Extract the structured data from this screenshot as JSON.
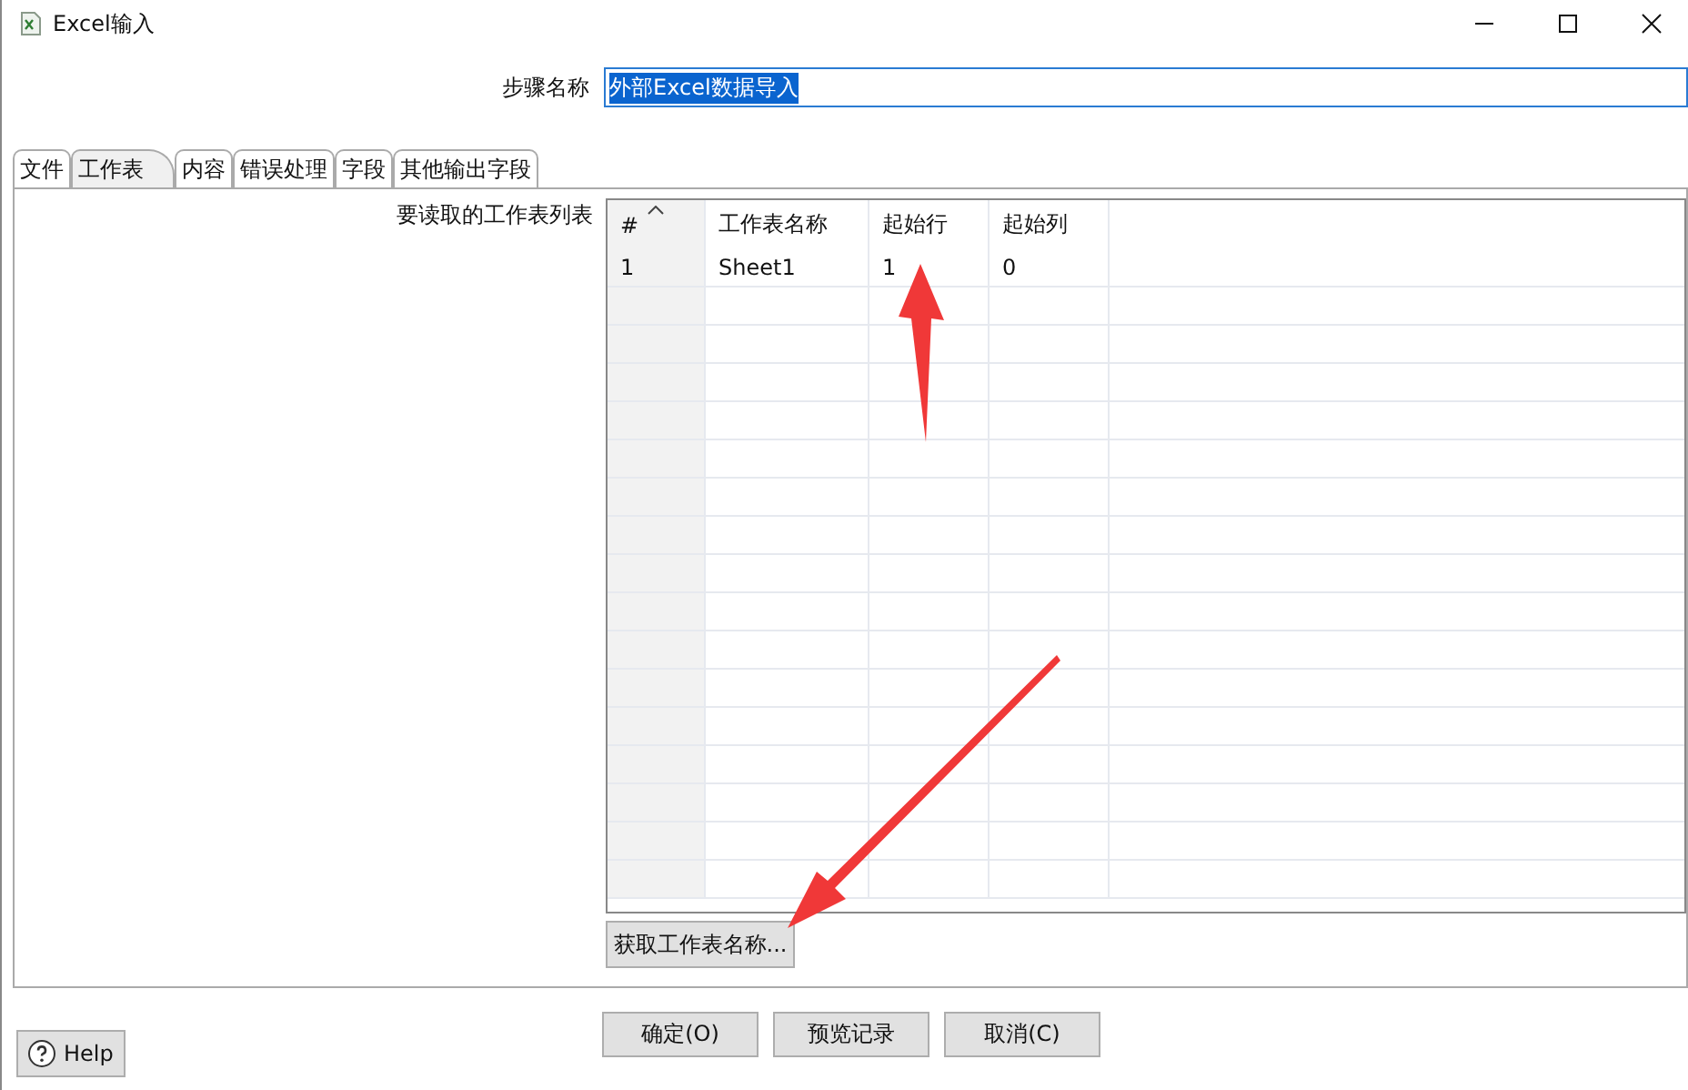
{
  "window": {
    "title": "Excel输入"
  },
  "step_name": {
    "label": "步骤名称",
    "value": "外部Excel数据导入"
  },
  "tabs": [
    {
      "label": "文件",
      "selected": false
    },
    {
      "label": "工作表",
      "selected": true
    },
    {
      "label": "内容",
      "selected": false
    },
    {
      "label": "错误处理",
      "selected": false
    },
    {
      "label": "字段",
      "selected": false
    },
    {
      "label": "其他输出字段",
      "selected": false
    }
  ],
  "sheet_list": {
    "label": "要读取的工作表列表",
    "table": {
      "columns": [
        "#",
        "工作表名称",
        "起始行",
        "起始列"
      ],
      "rows": [
        [
          "1",
          "Sheet1",
          "1",
          "0"
        ]
      ]
    },
    "button": "获取工作表名称..."
  },
  "buttons": [
    "确定(O)",
    "预览记录",
    "取消(C)"
  ],
  "help": "Help"
}
